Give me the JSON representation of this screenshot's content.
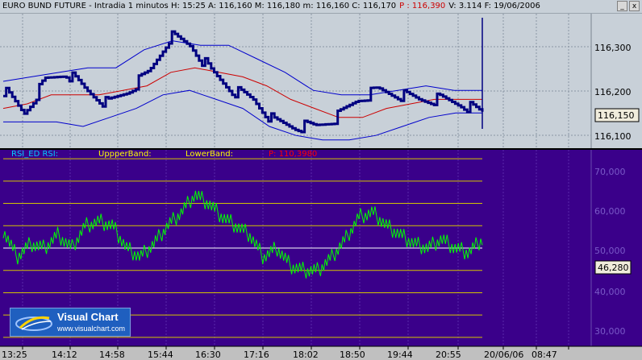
{
  "title_bar": {
    "segments": [
      {
        "text": "EURO BUND FUTURE - Intradia 1 minutos  H: 15:25  A: 116,160  M: 116,180  m: 116,160  C: 116,170",
        "color": "#000000"
      },
      {
        "text": "P : 116,390",
        "color": "#cc0000"
      },
      {
        "text": "V: 3.114  F: 19/06/2006",
        "color": "#000000"
      }
    ],
    "min_label": "_",
    "close_label": "x"
  },
  "price_panel": {
    "y_ticks": [
      "116,300",
      "116,200",
      "116,100"
    ],
    "current_price": "116,150",
    "colors": {
      "background": "#c8d0d8",
      "bars": "#000080",
      "bands": "#0000cc",
      "average": "#cc0000"
    }
  },
  "rsi_panel": {
    "legend": [
      {
        "text": "RSI_ED  RSI:",
        "color": "#00ccff"
      },
      {
        "text": "UppperBand:",
        "color": "#ffff00"
      },
      {
        "text": "LowerBand:",
        "color": "#ffff00"
      },
      {
        "text": "P: 110,3980",
        "color": "#ff0000"
      }
    ],
    "y_ticks": [
      "70,000",
      "60,000",
      "50,000",
      "40,000",
      "30,000"
    ],
    "current_value": "46,280",
    "colors": {
      "background": "#3a008a",
      "line": "#00ff00",
      "level_lines": "#d4c400",
      "fifty_line": "#ffffff"
    }
  },
  "time_axis": {
    "labels": [
      "13:25",
      "14:12",
      "14:58",
      "15:44",
      "16:30",
      "17:16",
      "18:02",
      "18:50",
      "19:44",
      "20:55",
      "20/06/06",
      "08:47"
    ]
  },
  "logo": {
    "name": "Visual Chart",
    "url": "www.visualchart.com"
  },
  "chart_data": [
    {
      "type": "line",
      "title": "EURO BUND FUTURE - Intradia 1 minutos",
      "y_range": [
        116.07,
        116.37
      ],
      "x": [
        "13:25",
        "14:12",
        "14:58",
        "15:44",
        "16:30",
        "17:16",
        "18:02",
        "18:50",
        "19:44",
        "20:55"
      ],
      "series": [
        {
          "values": [
            116.2,
            116.15,
            116.22,
            116.24,
            116.2,
            116.17,
            116.2,
            116.24,
            116.32,
            116.3,
            116.24,
            116.2,
            116.18,
            116.13,
            116.12,
            116.12,
            116.14,
            116.18,
            116.2,
            116.19,
            116.18,
            116.18,
            116.17,
            116.15
          ]
        },
        {
          "values": [
            116.16,
            116.17,
            116.19,
            116.19,
            116.19,
            116.2,
            116.21,
            116.24,
            116.25,
            116.24,
            116.23,
            116.21,
            116.18,
            116.16,
            116.14,
            116.14,
            116.16,
            116.17,
            116.18,
            116.18,
            116.18
          ]
        },
        {
          "values": [
            116.22,
            116.23,
            116.24,
            116.25,
            116.25,
            116.29,
            116.31,
            116.3,
            116.3,
            116.27,
            116.24,
            116.2,
            116.19,
            116.19,
            116.2,
            116.21,
            116.2,
            116.2
          ]
        },
        {
          "values": [
            116.13,
            116.13,
            116.13,
            116.12,
            116.14,
            116.16,
            116.19,
            116.2,
            116.18,
            116.16,
            116.12,
            116.1,
            116.09,
            116.09,
            116.1,
            116.12,
            116.14,
            116.15,
            116.15
          ]
        }
      ]
    },
    {
      "type": "line",
      "title": "RSI_ED",
      "y_range": [
        28,
        72
      ],
      "y_ticks": [
        70,
        60,
        50,
        40,
        30
      ],
      "series": [
        {
          "values": [
            54,
            48,
            51,
            50,
            53,
            50,
            55,
            56,
            55,
            50,
            48,
            51,
            55,
            58,
            62,
            60,
            57,
            55,
            53,
            48,
            50,
            46,
            45,
            45,
            48,
            52,
            57,
            58,
            55,
            53,
            51,
            50,
            52,
            50,
            49,
            52
          ]
        }
      ]
    }
  ]
}
